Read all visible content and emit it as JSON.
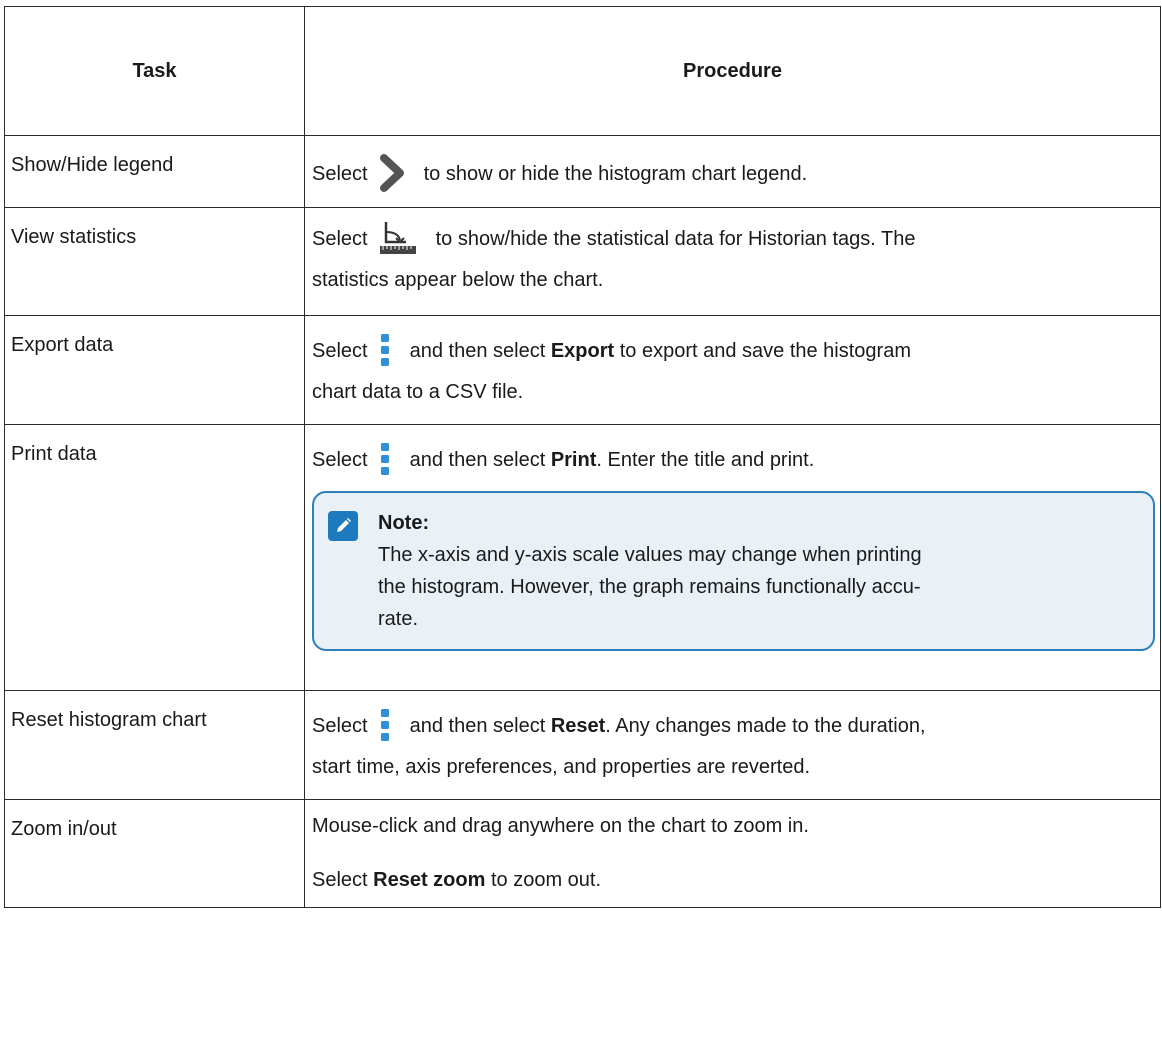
{
  "headers": {
    "task": "Task",
    "procedure": "Procedure"
  },
  "rows": [
    {
      "task": "Show/Hide legend",
      "select": "Select",
      "text": "to show or hide the histogram chart legend."
    },
    {
      "task": "View statistics",
      "select": "Select",
      "text1": "to show/hide the statistical data for Historian tags. The",
      "text2": "statistics appear below the chart."
    },
    {
      "task": "Export data",
      "select": "Select",
      "pre": "and then select",
      "bold": "Export",
      "post": "to export and save the histogram",
      "text2": "chart data to a CSV file."
    },
    {
      "task": "Print data",
      "select": "Select",
      "pre": "and then select",
      "bold": "Print",
      "post": ". Enter the title and print.",
      "note": {
        "title": "Note:",
        "line1": "The x-axis and y-axis scale values may change when printing",
        "line2": "the histogram. However, the graph remains functionally accu-",
        "line3": "rate."
      }
    },
    {
      "task": "Reset histogram chart",
      "select": "Select",
      "pre": "and then select",
      "bold": "Reset",
      "post": ". Any changes made to the duration,",
      "text2": "start time, axis preferences, and properties are reverted."
    },
    {
      "task": "Zoom in/out",
      "text1": "Mouse-click and drag anywhere on the chart to zoom in.",
      "pre": "Select",
      "bold": "Reset zoom",
      "post": "to zoom out."
    }
  ],
  "icons": {
    "chevron": "chevron-right-icon",
    "stats": "statistics-ruler-icon",
    "more": "more-vertical-icon",
    "note": "pencil-note-icon"
  },
  "colors": {
    "icon_gray": "#555555",
    "kebab_blue": "#2f8fd8",
    "note_bg": "#e9f1f7",
    "note_border": "#2c7fb8",
    "note_icon": "#1e7abf"
  }
}
